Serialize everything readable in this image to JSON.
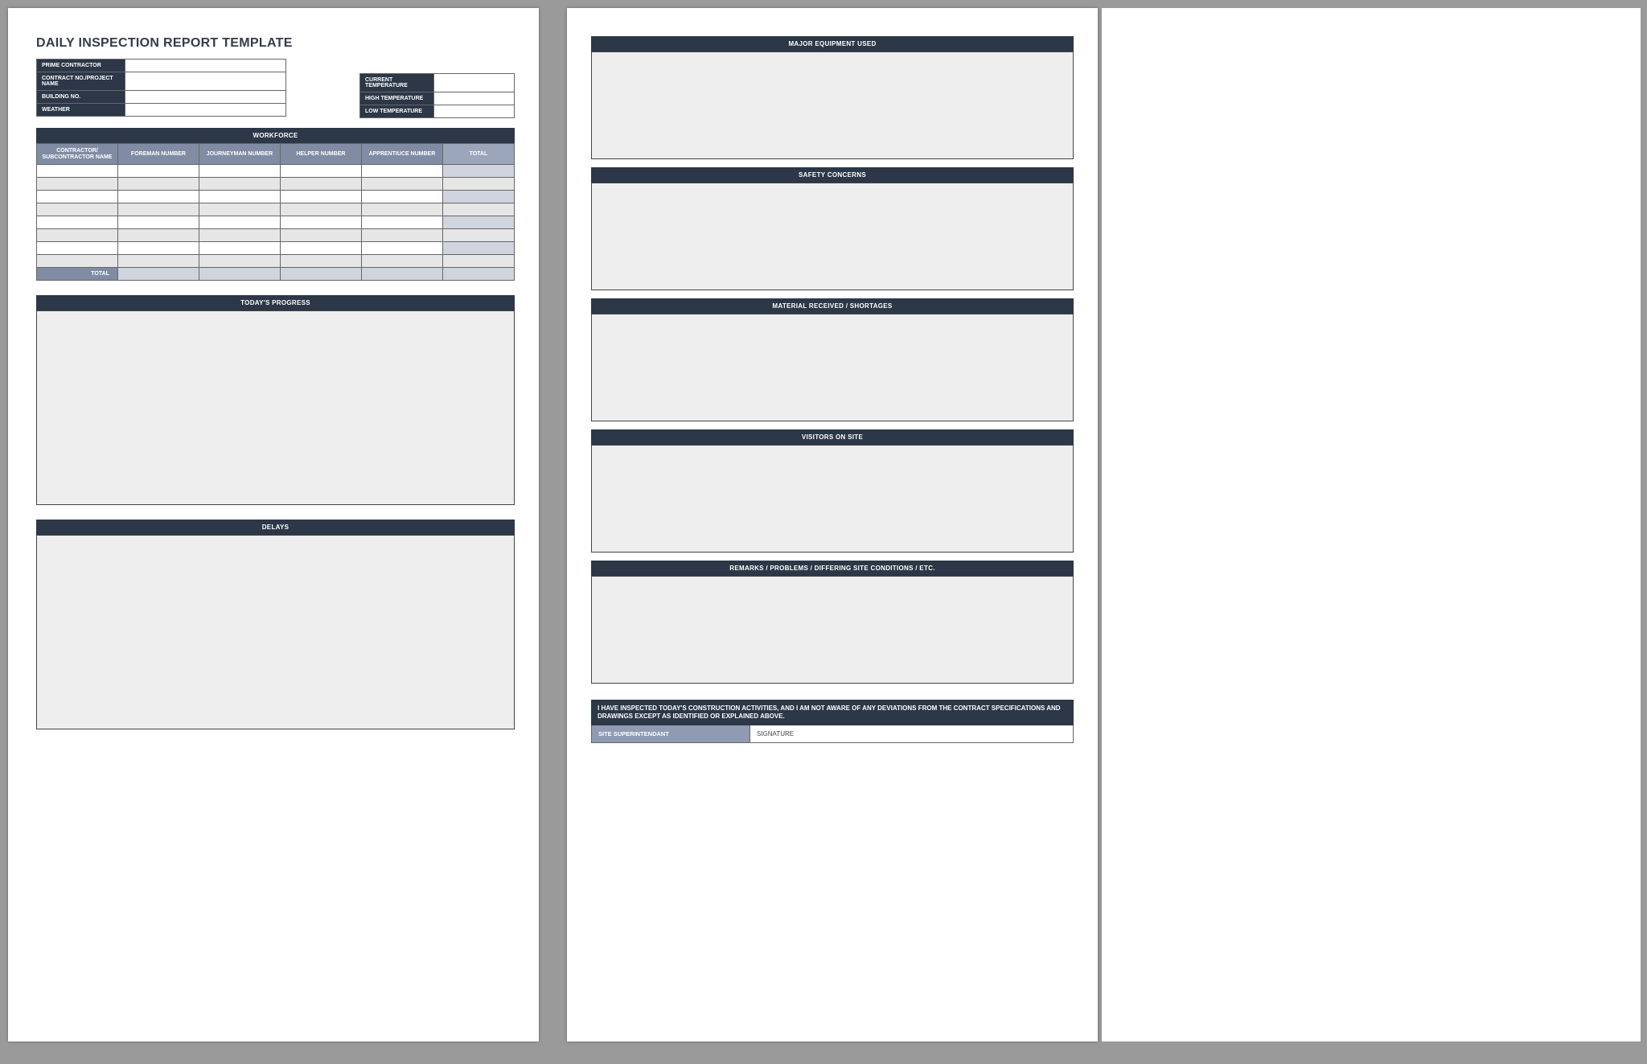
{
  "title": "DAILY INSPECTION REPORT TEMPLATE",
  "info": {
    "labels": {
      "prime_contractor": "PRIME CONTRACTOR",
      "contract_project": "CONTRACT NO./PROJECT NAME",
      "building_no": "BUILDING NO.",
      "weather": "WEATHER"
    },
    "temps": {
      "current": "CURRENT TEMPERATURE",
      "high": "HIGH TEMPERATURE",
      "low": "LOW TEMPERATURE"
    }
  },
  "workforce": {
    "header": "WORKFORCE",
    "cols": {
      "contractor": "CONTRACTOR/\nSUBCONTRACTOR NAME",
      "foreman": "FOREMAN NUMBER",
      "journeyman": "JOURNEYMAN NUMBER",
      "helper": "HELPER NUMBER",
      "apprentice": "APPRENTIUCE NUMBER",
      "total": "TOTAL"
    },
    "rows": 8,
    "total_label": "TOTAL"
  },
  "sections_p1": {
    "progress": "TODAY'S PROGRESS",
    "delays": "DELAYS"
  },
  "sections_p2": {
    "equipment": "MAJOR EQUIPMENT USED",
    "safety": "SAFETY CONCERNS",
    "materials": "MATERIAL RECEIVED / SHORTAGES",
    "visitors": "VISITORS ON SITE",
    "remarks": "REMARKS / PROBLEMS / DIFFERING SITE CONDITIONS / ETC."
  },
  "cert_text": "I HAVE INSPECTED TODAY'S CONSTRUCTION ACTIVITIES, AND I AM NOT AWARE OF ANY DEVIATIONS FROM THE CONTRACT SPECIFICATIONS AND DRAWINGS EXCEPT AS IDENTIFIED OR EXPLAINED ABOVE.",
  "sig": {
    "left": "SITE SUPERINTENDANT",
    "right": "SIGNATURE"
  }
}
